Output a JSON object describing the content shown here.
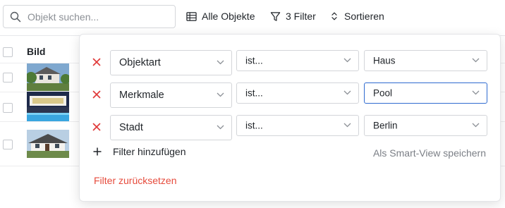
{
  "toolbar": {
    "search_placeholder": "Objekt suchen...",
    "all_objects_label": "Alle Objekte",
    "filter_label": "3 Filter",
    "sort_label": "Sortieren"
  },
  "table": {
    "column_image": "Bild",
    "rows": [
      {
        "thumbnail": "house-photo"
      },
      {
        "thumbnail": "pool-house-photo"
      },
      {
        "thumbnail": "white-house-photo"
      }
    ]
  },
  "filters": {
    "rows": [
      {
        "field": "Objektart",
        "operator": "ist...",
        "value": "Haus",
        "active": false
      },
      {
        "field": "Merkmale",
        "operator": "ist...",
        "value": "Pool",
        "active": true
      },
      {
        "field": "Stadt",
        "operator": "ist...",
        "value": "Berlin",
        "active": false
      }
    ],
    "add_label": "Filter hinzufügen",
    "save_smart_view_label": "Als Smart-View speichern",
    "reset_label": "Filter zurücksetzen"
  },
  "colors": {
    "remove": "#e03a3a",
    "reset": "#e64b3c",
    "active_border": "#2f6bd0"
  },
  "icons": {
    "search": "search-icon",
    "table": "table-icon",
    "filter": "filter-funnel-icon",
    "sort": "sort-icon",
    "remove": "close-icon",
    "dropdown": "chevron-down-icon",
    "add": "plus-icon"
  }
}
